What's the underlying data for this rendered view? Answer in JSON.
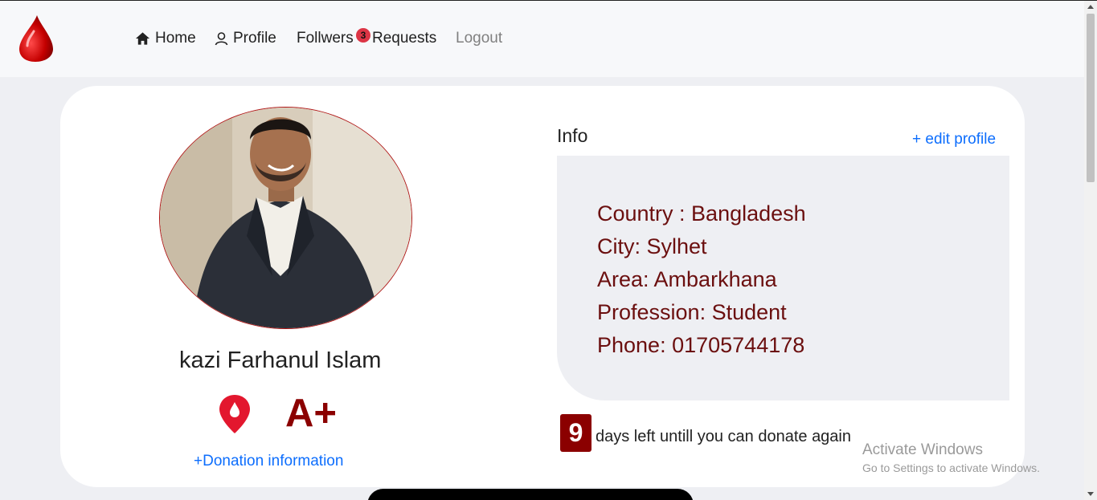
{
  "nav": {
    "home": "Home",
    "profile": "Profile",
    "followers": "Follwers",
    "requests": "Requests",
    "requests_badge": "3",
    "logout": "Logout",
    "home_icon": "home-icon",
    "profile_icon": "user-icon",
    "logo_icon": "blood-drop-logo"
  },
  "profile": {
    "name": "kazi Farhanul Islam",
    "blood_group": "A+",
    "location_icon": "location-pin-icon",
    "donation_link": "+Donation information"
  },
  "info": {
    "title": "Info",
    "edit_label": "+ edit profile",
    "rows": [
      "Country : Bangladesh",
      "City: Sylhet",
      "Area: Ambarkhana",
      "Profession: Student",
      "Phone: 01705744178"
    ]
  },
  "donation": {
    "days_left": "9",
    "days_text": "days left untill you can donate again"
  },
  "watermark": {
    "title": "Activate Windows",
    "subtitle": "Go to Settings to activate Windows."
  },
  "colors": {
    "accent_red": "#8b0000",
    "link_blue": "#0d6efd",
    "badge_red": "#dc3545"
  }
}
